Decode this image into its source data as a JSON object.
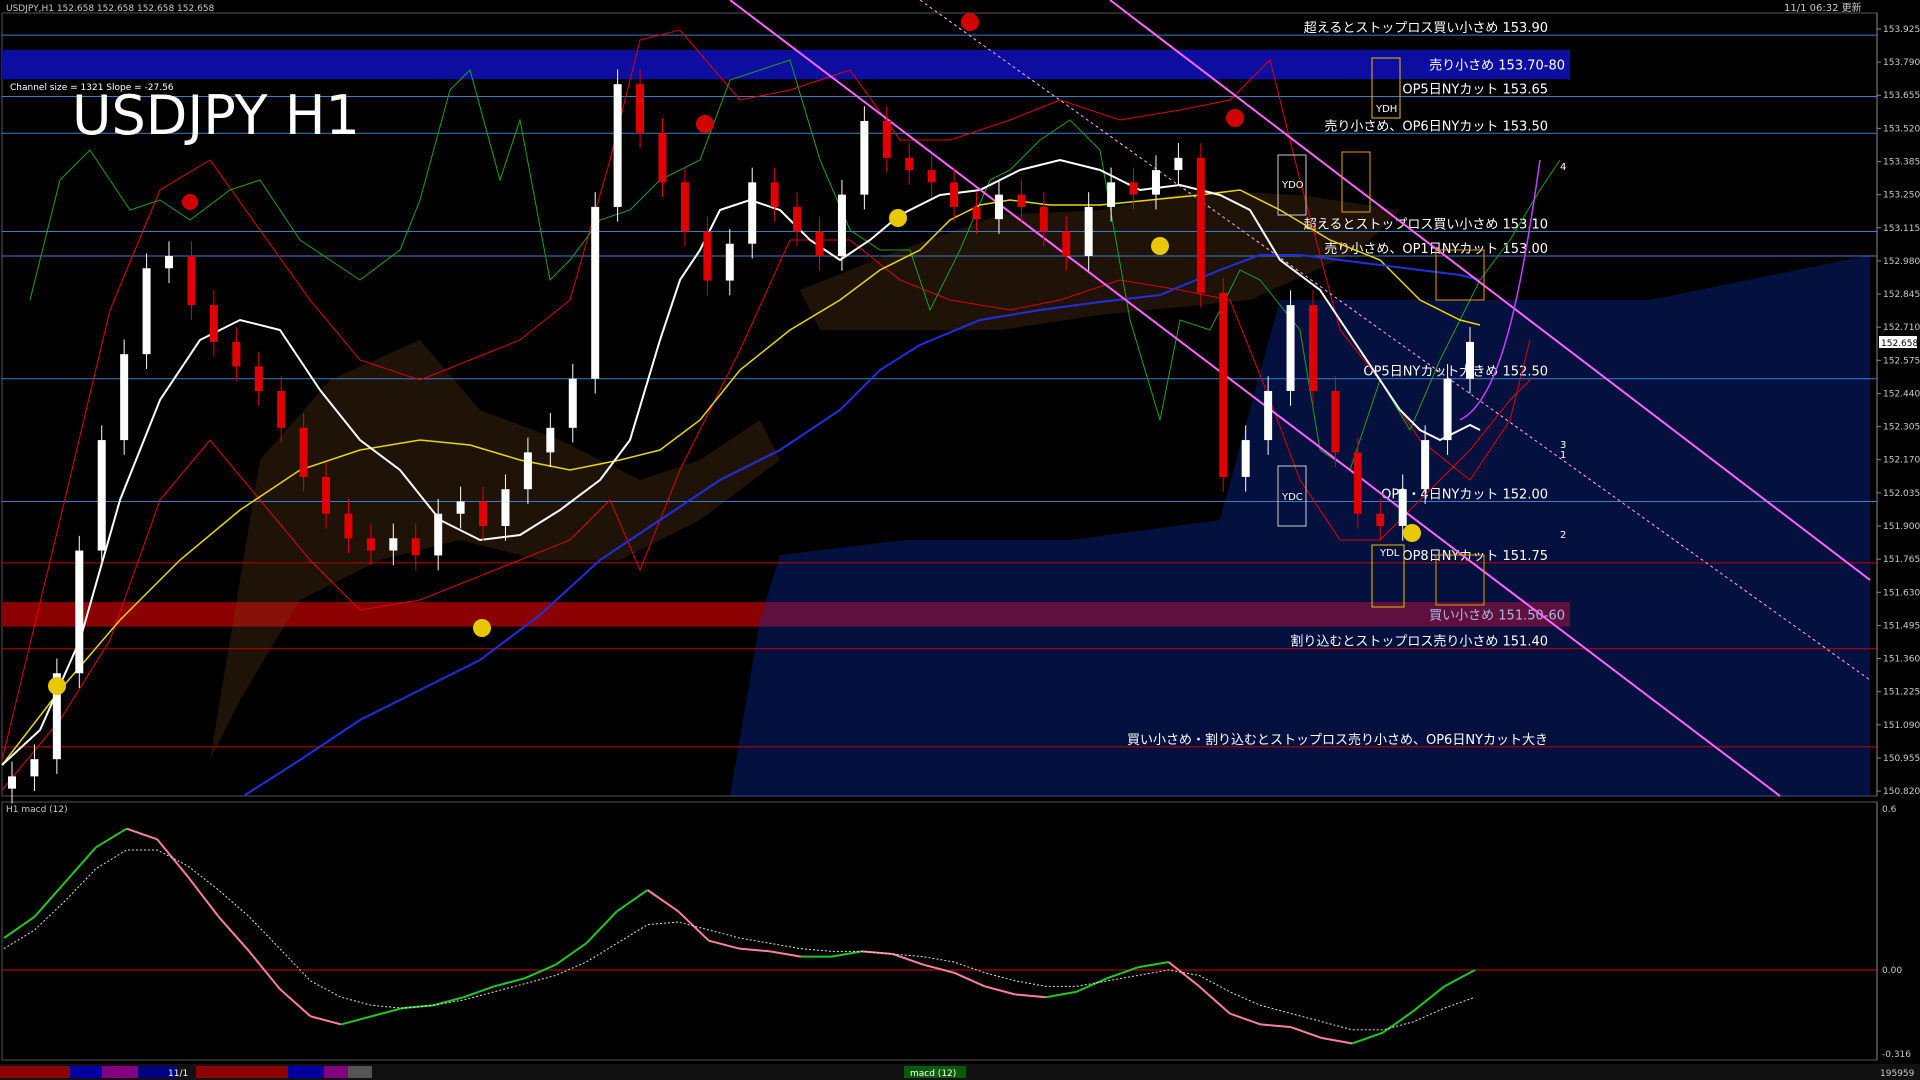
{
  "header": {
    "symbol_info": "USDJPY,H1  152.658 152.658 152.658 152.658",
    "update_time": "11/1 06:32 更新",
    "channel_info": "Channel size = 1321 Slope = -27.56",
    "title": "USDJPY H1",
    "current_price": "152.658"
  },
  "price_axis": {
    "ticks": [
      "153.925",
      "153.790",
      "153.655",
      "153.520",
      "153.385",
      "153.250",
      "153.115",
      "152.980",
      "152.845",
      "152.710",
      "152.575",
      "152.440",
      "152.305",
      "152.170",
      "152.035",
      "151.900",
      "151.765",
      "151.630",
      "151.495",
      "151.360",
      "151.225",
      "151.090",
      "150.955",
      "150.820"
    ],
    "range": [
      150.8,
      153.99
    ]
  },
  "levels": [
    {
      "price": 153.9,
      "text": "超えるとストップロス買い小さめ 153.90",
      "color": "#3b7cc7"
    },
    {
      "price": 153.65,
      "text": "OP5日NYカット 153.65",
      "color": "#3b7cc7"
    },
    {
      "price": 153.5,
      "text": "売り小さめ、OP6日NYカット 153.50",
      "color": "#3b7cc7"
    },
    {
      "price": 153.1,
      "text": "超えるとストップロス買い小さめ 153.10",
      "color": "#3b7cc7"
    },
    {
      "price": 153.0,
      "text": "売り小さめ、OP1日NYカット 153.00",
      "color": "#3b7cc7"
    },
    {
      "price": 152.5,
      "text": "OP5日NYカット大きめ 152.50",
      "color": "#3b7cc7"
    },
    {
      "price": 152.0,
      "text": "OP1・4日NYカット 152.00",
      "color": "#3b7cc7"
    },
    {
      "price": 151.75,
      "text": "OP8日NYカット 151.75",
      "color": "#c00000"
    },
    {
      "price": 151.4,
      "text": "割り込むとストップロス売り小さめ 151.40",
      "color": "#c00000"
    },
    {
      "price": 151.0,
      "text": "買い小さめ・割り込むとストップロス売り小さめ、OP6日NYカット大き",
      "color": "#c00000"
    }
  ],
  "zones": [
    {
      "top": 153.84,
      "bottom": 153.72,
      "text": "売り小さめ 153.70-80",
      "color": "#0d0da0"
    },
    {
      "top": 151.59,
      "bottom": 151.49,
      "text": "買い小さめ 151.50-60",
      "color": "#8b0000"
    }
  ],
  "box_labels": [
    "YDH",
    "YDO",
    "YDC",
    "YDL"
  ],
  "wave_labels": [
    "4",
    "3",
    "2",
    "1"
  ],
  "macd": {
    "title": "H1  macd (12)",
    "axis_ticks": [
      "0.6",
      "0.00",
      "-0.316"
    ],
    "line_values": [
      0.12,
      0.2,
      0.33,
      0.46,
      0.53,
      0.49,
      0.35,
      0.2,
      0.07,
      -0.07,
      -0.17,
      -0.2,
      -0.17,
      -0.14,
      -0.13,
      -0.1,
      -0.06,
      -0.03,
      0.02,
      0.1,
      0.22,
      0.3,
      0.22,
      0.11,
      0.08,
      0.07,
      0.05,
      0.05,
      0.07,
      0.06,
      0.02,
      -0.01,
      -0.06,
      -0.09,
      -0.1,
      -0.08,
      -0.03,
      0.01,
      0.03,
      -0.06,
      -0.16,
      -0.2,
      -0.21,
      -0.25,
      -0.27,
      -0.23,
      -0.15,
      -0.06,
      0.0
    ],
    "signal_values": [
      0.08,
      0.15,
      0.26,
      0.38,
      0.45,
      0.45,
      0.39,
      0.3,
      0.2,
      0.08,
      -0.04,
      -0.1,
      -0.13,
      -0.14,
      -0.13,
      -0.11,
      -0.08,
      -0.05,
      -0.02,
      0.03,
      0.1,
      0.17,
      0.18,
      0.15,
      0.12,
      0.1,
      0.08,
      0.07,
      0.07,
      0.06,
      0.05,
      0.03,
      -0.01,
      -0.04,
      -0.06,
      -0.06,
      -0.04,
      -0.02,
      0.0,
      -0.02,
      -0.08,
      -0.13,
      -0.16,
      -0.19,
      -0.22,
      -0.22,
      -0.19,
      -0.14,
      -0.1
    ]
  },
  "bottom_bar": {
    "date_label": "11/1",
    "indicator_label": "macd (12)",
    "right_value": "195959",
    "swatches": [
      "#8b0000",
      "#0000a0",
      "#800080",
      "#000080",
      "#8b0000",
      "#8b0000",
      "#0000a0",
      "#800080",
      "#555555"
    ]
  },
  "chart_data": {
    "type": "candlestick",
    "title": "USDJPY H1",
    "timeframe": "H1",
    "ylim": [
      150.8,
      153.99
    ],
    "close_estimates": [
      150.88,
      150.95,
      151.3,
      151.8,
      152.25,
      152.6,
      152.95,
      153.0,
      152.8,
      152.65,
      152.55,
      152.45,
      152.3,
      152.1,
      151.95,
      151.85,
      151.8,
      151.85,
      151.78,
      151.95,
      152.0,
      151.9,
      152.05,
      152.2,
      152.3,
      152.5,
      153.2,
      153.7,
      153.5,
      153.3,
      153.1,
      152.9,
      153.05,
      153.3,
      153.2,
      153.1,
      153.0,
      153.25,
      153.55,
      153.4,
      153.35,
      153.3,
      153.2,
      153.15,
      153.25,
      153.2,
      153.1,
      153.0,
      153.2,
      153.3,
      153.25,
      153.35,
      153.4,
      152.85,
      152.1,
      152.25,
      152.45,
      152.8,
      152.45,
      152.2,
      151.95,
      151.9,
      152.05,
      152.25,
      152.5,
      152.65
    ]
  }
}
